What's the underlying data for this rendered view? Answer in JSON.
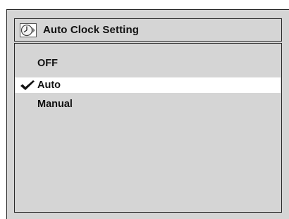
{
  "header": {
    "title": "Auto Clock Setting",
    "icon": "clock-icon"
  },
  "options": [
    {
      "label": "OFF",
      "selected": false
    },
    {
      "label": "Auto",
      "selected": true
    },
    {
      "label": "Manual",
      "selected": false
    }
  ],
  "selection_marker_icon": "checkmark-icon"
}
